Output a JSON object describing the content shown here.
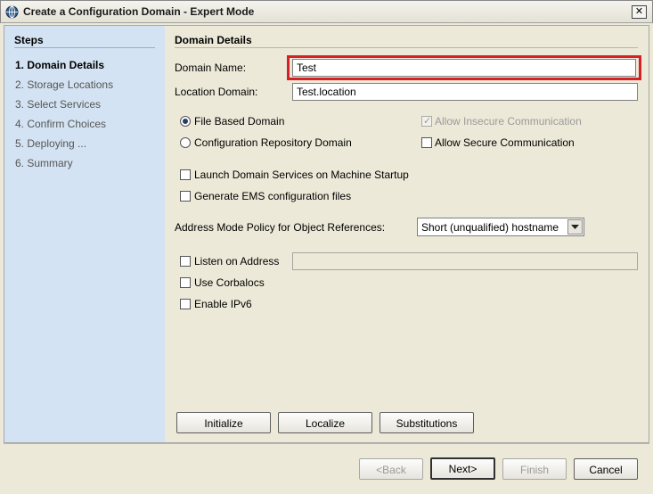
{
  "window": {
    "title": "Create a Configuration Domain - Expert Mode",
    "close_label": "✕"
  },
  "steps": {
    "heading": "Steps",
    "items": [
      {
        "label": "1. Domain Details",
        "active": true
      },
      {
        "label": "2. Storage Locations",
        "active": false
      },
      {
        "label": "3. Select Services",
        "active": false
      },
      {
        "label": "4. Confirm Choices",
        "active": false
      },
      {
        "label": "5. Deploying ...",
        "active": false
      },
      {
        "label": "6. Summary",
        "active": false
      }
    ]
  },
  "details": {
    "section_title": "Domain Details",
    "domain_name_label": "Domain Name:",
    "domain_name_value": "Test",
    "location_domain_label": "Location Domain:",
    "location_domain_value": "Test.location",
    "file_based_label": "File Based Domain",
    "file_based_checked": true,
    "config_repo_label": "Configuration Repository Domain",
    "config_repo_checked": false,
    "allow_insecure_label": "Allow Insecure Communication",
    "allow_insecure_checked": true,
    "allow_insecure_enabled": false,
    "allow_secure_label": "Allow Secure Communication",
    "allow_secure_checked": false,
    "launch_services_label": "Launch Domain Services on Machine Startup",
    "launch_services_checked": false,
    "generate_ems_label": "Generate EMS configuration files",
    "generate_ems_checked": false,
    "address_mode_label": "Address Mode Policy for Object References:",
    "address_mode_value": "Short (unqualified) hostname",
    "listen_on_address_label": "Listen on Address",
    "listen_on_address_checked": false,
    "listen_on_address_value": "",
    "use_corbalocs_label": "Use Corbalocs",
    "use_corbalocs_checked": false,
    "enable_ipv6_label": "Enable IPv6",
    "enable_ipv6_checked": false
  },
  "actions": {
    "initialize": "Initialize",
    "localize": "Localize",
    "substitutions": "Substitutions"
  },
  "nav": {
    "back": "<Back",
    "next": "Next>",
    "finish": "Finish",
    "cancel": "Cancel"
  },
  "colors": {
    "highlight": "#d62026",
    "steps_background": "#d4e3f3",
    "window_background": "#ece9d8"
  }
}
